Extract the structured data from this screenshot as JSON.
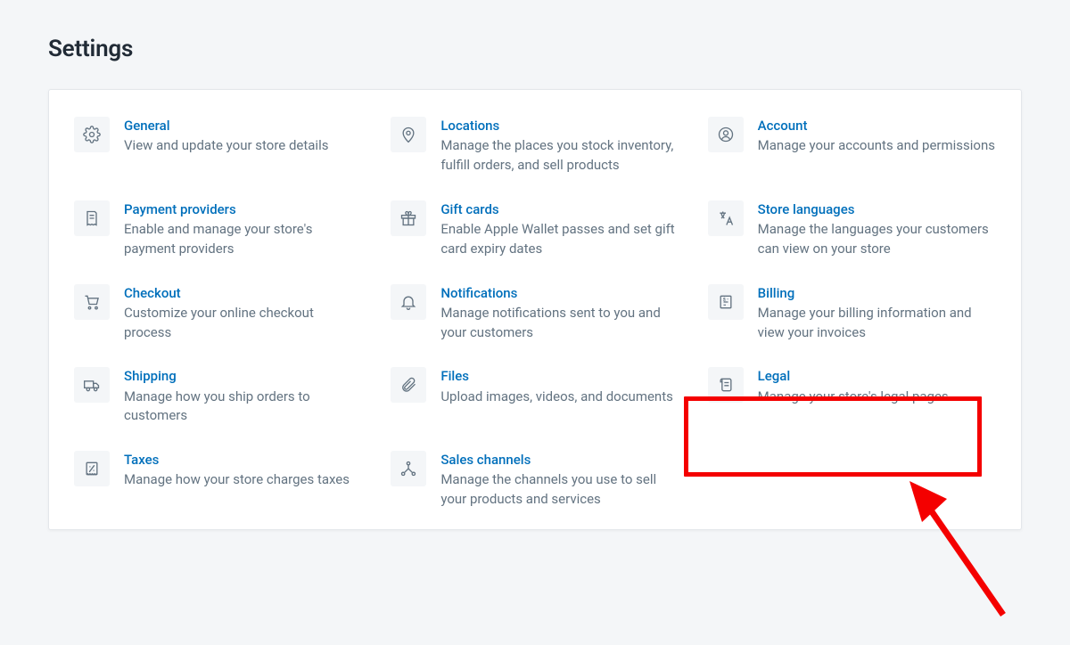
{
  "page_title": "Settings",
  "items": [
    {
      "id": "general",
      "icon": "gear",
      "title": "General",
      "desc": "View and update your store details"
    },
    {
      "id": "locations",
      "icon": "pin",
      "title": "Locations",
      "desc": "Manage the places you stock inventory, fulfill orders, and sell products"
    },
    {
      "id": "account",
      "icon": "user",
      "title": "Account",
      "desc": "Manage your accounts and permissions"
    },
    {
      "id": "payment-providers",
      "icon": "receipt",
      "title": "Payment providers",
      "desc": "Enable and manage your store's payment providers"
    },
    {
      "id": "gift-cards",
      "icon": "gift",
      "title": "Gift cards",
      "desc": "Enable Apple Wallet passes and set gift card expiry dates"
    },
    {
      "id": "store-languages",
      "icon": "translate",
      "title": "Store languages",
      "desc": "Manage the languages your customers can view on your store"
    },
    {
      "id": "checkout",
      "icon": "cart",
      "title": "Checkout",
      "desc": "Customize your online checkout process"
    },
    {
      "id": "notifications",
      "icon": "bell",
      "title": "Notifications",
      "desc": "Manage notifications sent to you and your customers"
    },
    {
      "id": "billing",
      "icon": "invoice",
      "title": "Billing",
      "desc": "Manage your billing information and view your invoices"
    },
    {
      "id": "shipping",
      "icon": "truck",
      "title": "Shipping",
      "desc": "Manage how you ship orders to customers"
    },
    {
      "id": "files",
      "icon": "clip",
      "title": "Files",
      "desc": "Upload images, videos, and documents"
    },
    {
      "id": "legal",
      "icon": "scroll",
      "title": "Legal",
      "desc": "Manage your store's legal pages"
    },
    {
      "id": "taxes",
      "icon": "percent",
      "title": "Taxes",
      "desc": "Manage how your store charges taxes"
    },
    {
      "id": "sales-channels",
      "icon": "channels",
      "title": "Sales channels",
      "desc": "Manage the channels you use to sell your products and services"
    }
  ],
  "highlighted_id": "legal",
  "annotation": {
    "highlight_color": "#f40000",
    "arrow": true
  }
}
